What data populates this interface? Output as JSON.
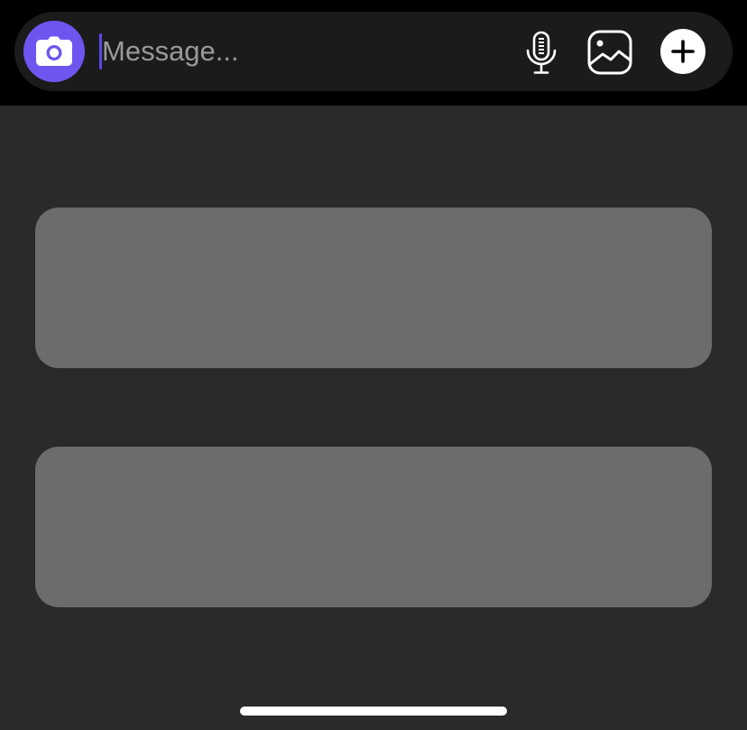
{
  "composer": {
    "camera_icon": "camera-icon",
    "message_placeholder": "Message...",
    "message_value": "",
    "mic_icon": "microphone-icon",
    "gallery_icon": "image-gallery-icon",
    "plus_icon": "plus-icon"
  },
  "colors": {
    "accent": "#6f55f0",
    "cursor": "#5a48e8",
    "composer_bg": "#1b1b1b",
    "content_bg": "#2a2a2a",
    "card_bg": "#6c6c6c"
  }
}
